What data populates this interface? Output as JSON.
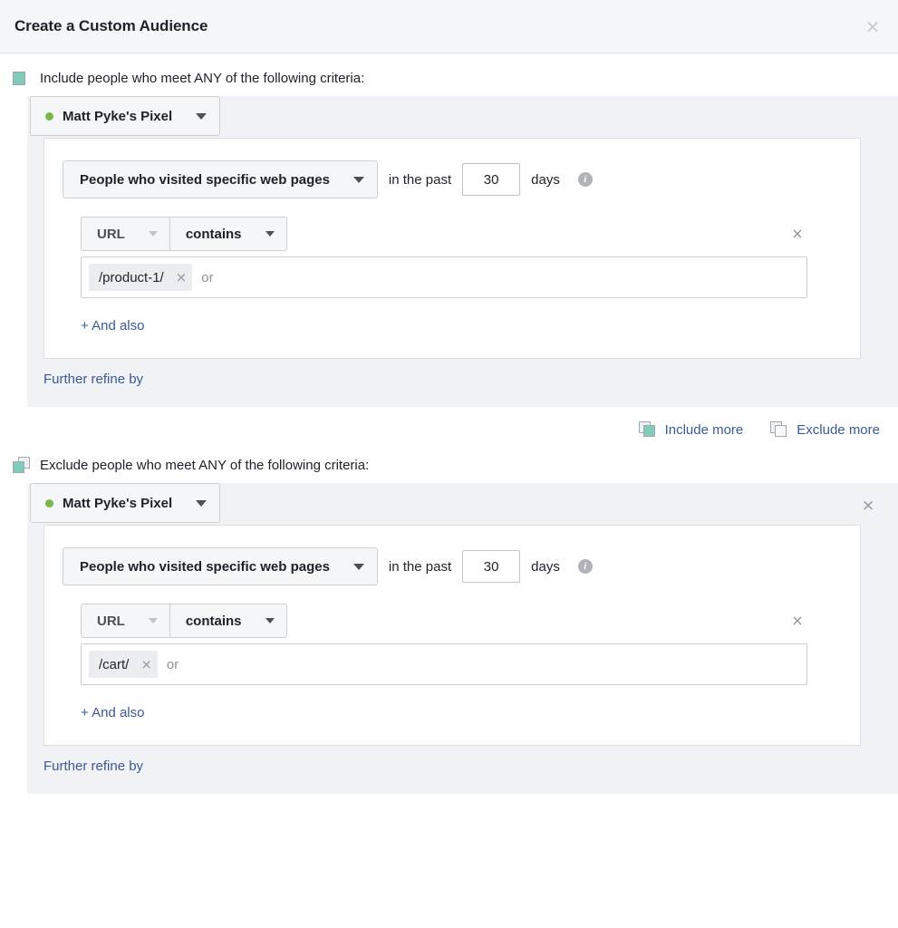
{
  "dialog": {
    "title": "Create a Custom Audience",
    "close_label": "×",
    "close_icon": "close-icon"
  },
  "include_section": {
    "icon": "include-square-icon",
    "label": "Include people who meet ANY of the following criteria:",
    "pixel": {
      "name": "Matt Pyke's Pixel",
      "status_dot_color": "#7ab648",
      "caret_icon": "chevron-down-icon"
    },
    "rule": {
      "event_label": "People who visited specific web pages",
      "event_caret_icon": "chevron-down-icon",
      "prefix_text": "in the past",
      "days_value": "30",
      "days_label": "days",
      "info_icon": "info-icon",
      "info_glyph": "i"
    },
    "condition": {
      "field_label": "URL",
      "field_caret_icon": "chevron-down-icon",
      "operator_label": "contains",
      "operator_caret_icon": "chevron-down-icon",
      "remove_label": "×",
      "remove_icon": "close-icon",
      "token_value": "/product-1/",
      "token_remove_label": "×",
      "placeholder": "or"
    },
    "and_also_label": "+ And also",
    "refine_label": "Further refine by"
  },
  "more_links": {
    "include_more": {
      "label": "Include more",
      "icon": "include-more-stack-icon"
    },
    "exclude_more": {
      "label": "Exclude more",
      "icon": "exclude-more-stack-icon"
    }
  },
  "exclude_section": {
    "icon": "exclude-square-icon",
    "label": "Exclude people who meet ANY of the following criteria:",
    "pixel": {
      "name": "Matt Pyke's Pixel",
      "status_dot_color": "#7ab648",
      "caret_icon": "chevron-down-icon"
    },
    "section_close_label": "×",
    "rule": {
      "event_label": "People who visited specific web pages",
      "event_caret_icon": "chevron-down-icon",
      "prefix_text": "in the past",
      "days_value": "30",
      "days_label": "days",
      "info_icon": "info-icon",
      "info_glyph": "i"
    },
    "condition": {
      "field_label": "URL",
      "field_caret_icon": "chevron-down-icon",
      "operator_label": "contains",
      "operator_caret_icon": "chevron-down-icon",
      "remove_label": "×",
      "remove_icon": "close-icon",
      "token_value": "/cart/",
      "token_remove_label": "×",
      "placeholder": "or"
    },
    "and_also_label": "+ And also",
    "refine_label": "Further refine by"
  },
  "theme": {
    "accent_link": "#3b5998",
    "include_green": "#7fccbb",
    "pixel_dot_green": "#7ab648",
    "panel_gray": "#f0f2f5",
    "header_gray": "#f5f6f7"
  }
}
